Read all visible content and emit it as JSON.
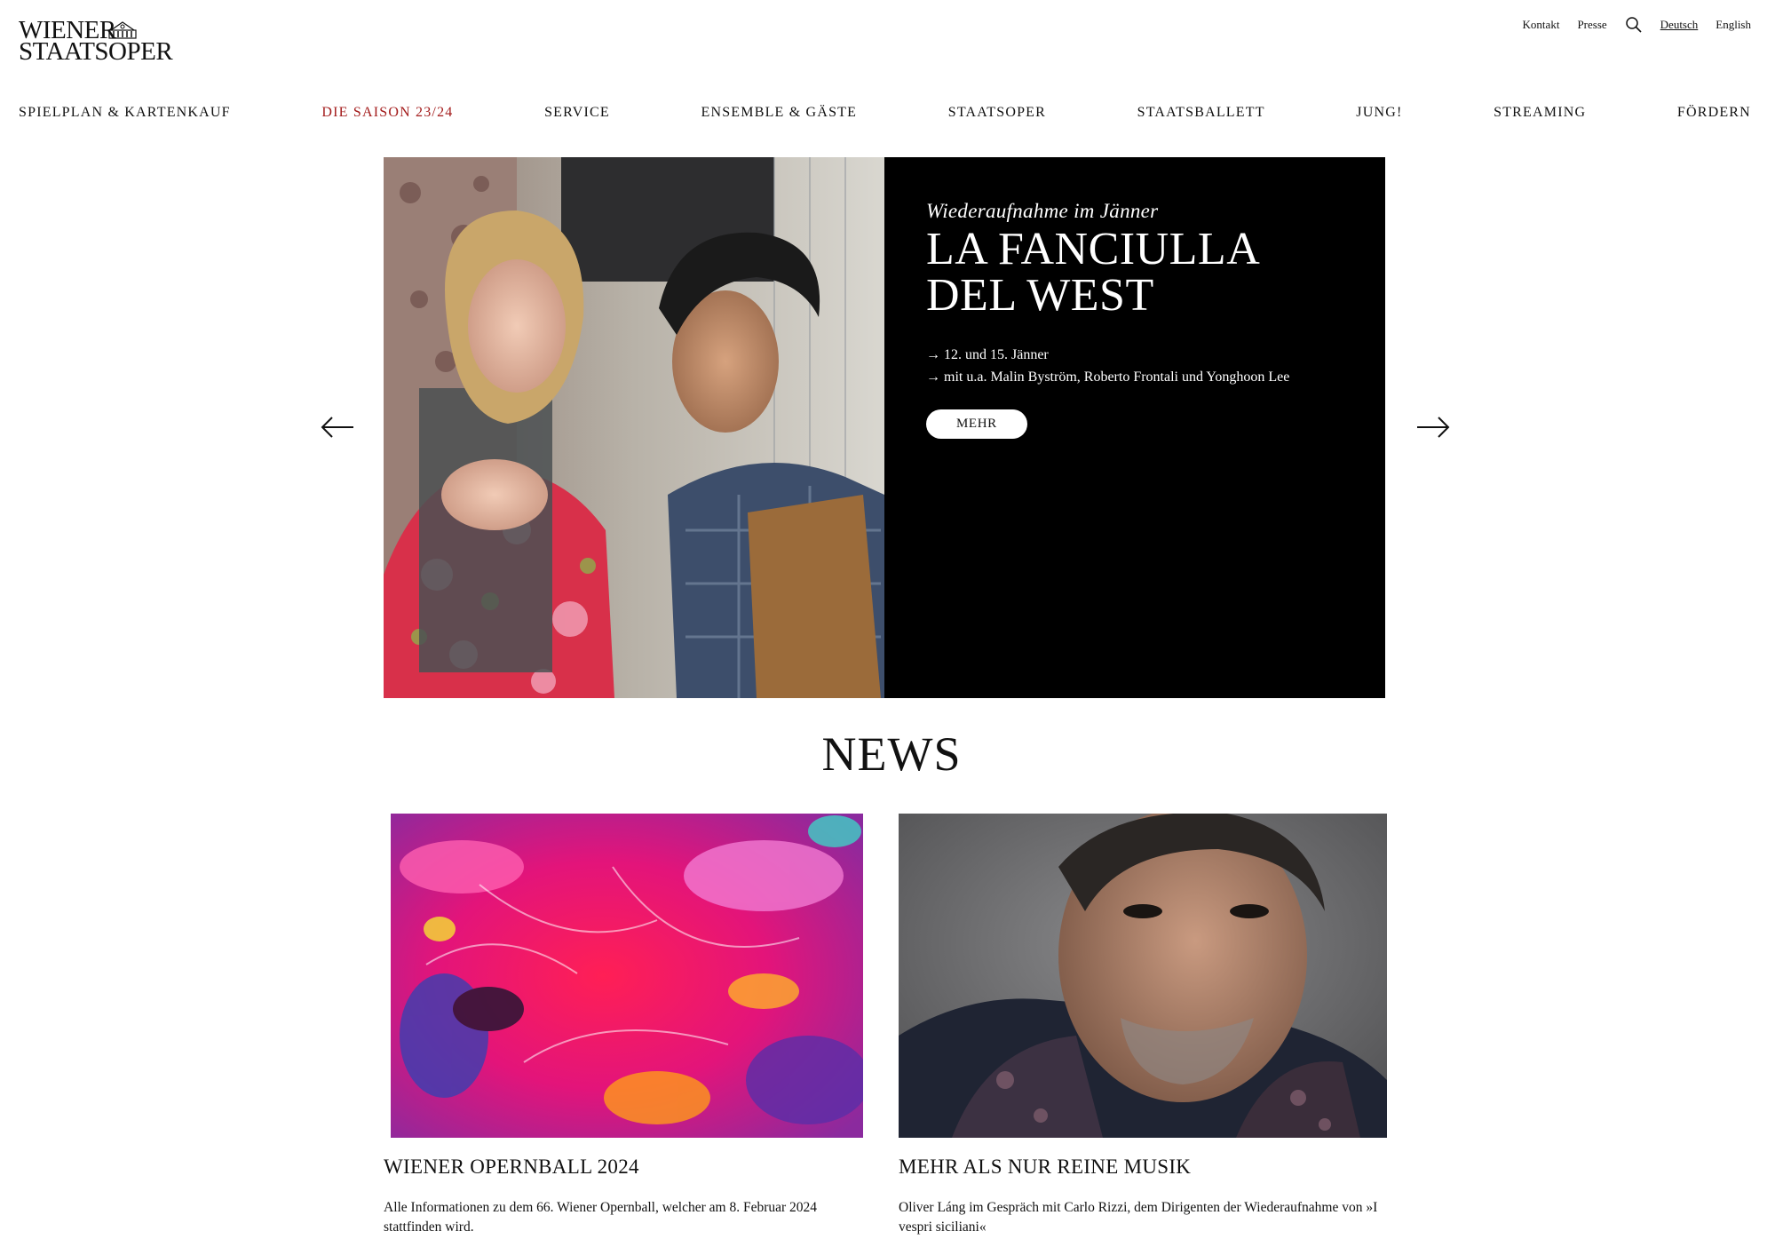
{
  "brand": {
    "line1": "WIENER",
    "line2": "STAATSOPER"
  },
  "topbar": {
    "contact": "Kontakt",
    "press": "Presse",
    "lang_de": "Deutsch",
    "lang_en": "English"
  },
  "nav": [
    {
      "label": "SPIELPLAN & KARTENKAUF"
    },
    {
      "label": "DIE SAISON 23/24"
    },
    {
      "label": "SERVICE"
    },
    {
      "label": "ENSEMBLE & GÄSTE"
    },
    {
      "label": "STAATSOPER"
    },
    {
      "label": "STAATSBALLETT"
    },
    {
      "label": "JUNG!"
    },
    {
      "label": "STREAMING"
    },
    {
      "label": "FÖRDERN"
    }
  ],
  "hero": {
    "kicker": "Wiederaufnahme im Jänner",
    "title": "LA FANCIULLA DEL WEST",
    "line1": "→ 12. und 15. Jänner",
    "line2": "→ mit u.a. Malin Byström, Roberto Frontali und Yonghoon Lee",
    "button": "MEHR"
  },
  "news": {
    "title": "NEWS",
    "cards": [
      {
        "title": "WIENER OPERNBALL 2024",
        "text": "Alle Informationen zu dem 66. Wiener Opernball, welcher am 8. Februar 2024 stattfinden wird."
      },
      {
        "title": "MEHR ALS NUR REINE MUSIK",
        "text": "Oliver Láng im Gespräch mit Carlo Rizzi, dem Dirigenten der Wiederaufnahme von »I vespri siciliani«"
      }
    ]
  },
  "colors": {
    "accent": "#a31b1b",
    "hero_panel": "#000000"
  },
  "icons": {
    "search": "search-icon",
    "prev": "arrow-left-icon",
    "next": "arrow-right-icon"
  }
}
